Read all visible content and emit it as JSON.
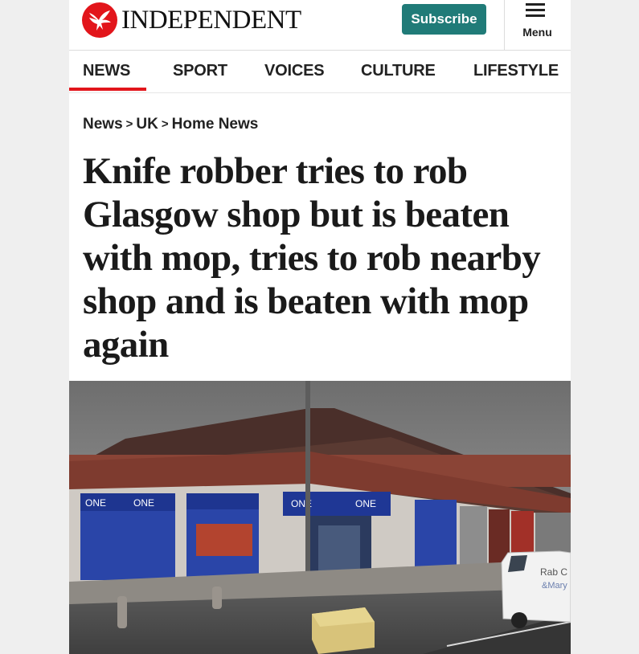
{
  "brand": {
    "name": "INDEPENDENT",
    "accent": "#e2151b"
  },
  "header": {
    "subscribe_label": "Subscribe",
    "subscribe_color": "#207b78",
    "menu_label": "Menu"
  },
  "nav": {
    "items": [
      "NEWS",
      "SPORT",
      "VOICES",
      "CULTURE",
      "LIFESTYLE"
    ],
    "active": "NEWS"
  },
  "breadcrumb": [
    "News",
    "UK",
    "Home News"
  ],
  "breadcrumb_separator": ">",
  "article": {
    "headline": "Knife robber tries to rob Glasgow shop but is beaten with mop, tries to rob nearby shop and is beaten with mop again"
  },
  "photo": {
    "sign_text": [
      "ONE",
      "ONE",
      "ONE",
      "ONE"
    ],
    "van_text": [
      "Rab C",
      "&Mary"
    ]
  }
}
